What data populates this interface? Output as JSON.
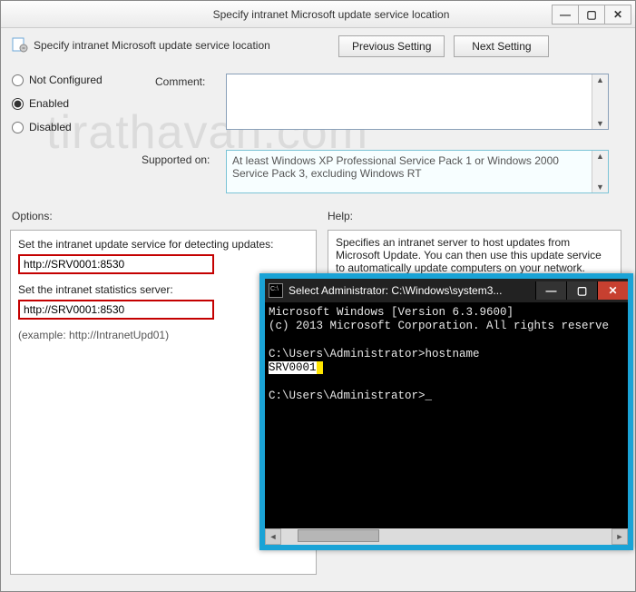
{
  "window": {
    "title": "Specify intranet Microsoft update service location",
    "min_label": "—",
    "max_label": "▢",
    "close_label": "✕"
  },
  "header": {
    "subtitle": "Specify intranet Microsoft update service location",
    "prev_button": "Previous Setting",
    "next_button": "Next Setting"
  },
  "radios": {
    "not_configured": "Not Configured",
    "enabled": "Enabled",
    "disabled": "Disabled",
    "selected": "enabled"
  },
  "comment": {
    "label": "Comment:",
    "value": ""
  },
  "supported": {
    "label": "Supported on:",
    "value": "At least Windows XP Professional Service Pack 1 or Windows 2000 Service Pack 3, excluding Windows RT"
  },
  "labels": {
    "options": "Options:",
    "help": "Help:"
  },
  "options": {
    "detect_label": "Set the intranet update service for detecting updates:",
    "detect_value": "http://SRV0001:8530",
    "stats_label": "Set the intranet statistics server:",
    "stats_value": "http://SRV0001:8530",
    "example": "(example: http://IntranetUpd01)"
  },
  "help": {
    "text": "Specifies an intranet server to host updates from Microsoft Update. You can then use this update service to automatically update computers on your network."
  },
  "watermark": "tirathavan.com",
  "console": {
    "title": "Select Administrator: C:\\Windows\\system3...",
    "min_label": "—",
    "max_label": "▢",
    "close_label": "✕",
    "line1": "Microsoft Windows [Version 6.3.9600]",
    "line2": "(c) 2013 Microsoft Corporation. All rights reserve",
    "prompt1": "C:\\Users\\Administrator>",
    "cmd1": "hostname",
    "output1": "SRV0001",
    "prompt2": "C:\\Users\\Administrator>",
    "cursor": "_"
  }
}
